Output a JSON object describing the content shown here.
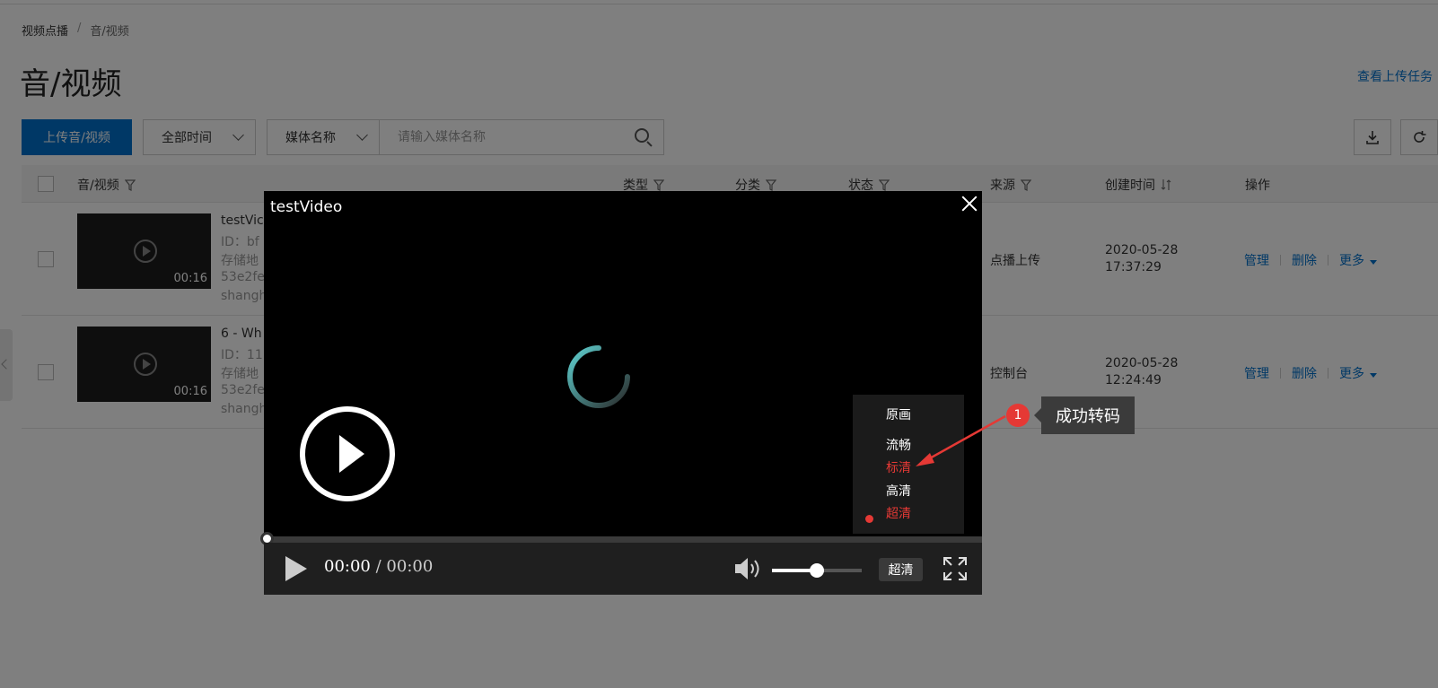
{
  "breadcrumb": {
    "root": "视频点播",
    "separator": "/",
    "current": "音/视频"
  },
  "page_title": "音/视频",
  "upload_tasks_link": "查看上传任务",
  "toolbar": {
    "upload_button": "上传音/视频",
    "time_select": "全部时间",
    "field_select": "媒体名称",
    "search_placeholder": "请输入媒体名称"
  },
  "table": {
    "headers": {
      "media": "音/视频",
      "type": "类型",
      "category": "分类",
      "status": "状态",
      "source": "来源",
      "created": "创建时间",
      "ops": "操作"
    },
    "rows": [
      {
        "title": "testVic",
        "id_line": "ID：bf",
        "storage_line": "存储地",
        "hash_line": "53e2fe",
        "region_line": "shangh",
        "duration": "00:16",
        "source": "点播上传",
        "date": "2020-05-28",
        "time": "17:37:29"
      },
      {
        "title": "6 - Wh",
        "id_line": "ID：11",
        "storage_line": "存储地",
        "hash_line": "53e2fe",
        "region_line": "shangh",
        "duration": "00:16",
        "source": "控制台",
        "date": "2020-05-28",
        "time": "12:24:49"
      }
    ],
    "actions": {
      "manage": "管理",
      "delete": "删除",
      "more": "更多"
    }
  },
  "player": {
    "title": "testVideo",
    "current_time": "00:00",
    "time_separator": "/",
    "total_time": "00:00",
    "volume_level": 0.5,
    "quality_label": "超清",
    "quality_options": [
      {
        "label": "原画",
        "highlight": false
      },
      {
        "label": "流畅",
        "highlight": false
      },
      {
        "label": "标清",
        "highlight": true
      },
      {
        "label": "高清",
        "highlight": false
      },
      {
        "label": "超清",
        "highlight": true,
        "selected": true
      }
    ]
  },
  "annotation": {
    "badge": "1",
    "text": "成功转码"
  },
  "colors": {
    "primary": "#0070cc",
    "annotation_red": "#e53935"
  }
}
